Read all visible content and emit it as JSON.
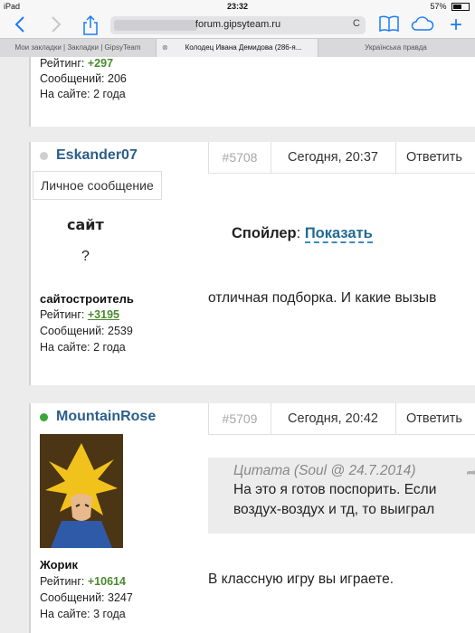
{
  "statusbar": {
    "device": "iPad",
    "time": "23:32",
    "battery": "57%",
    "battery_level": 0.57
  },
  "toolbar": {
    "back_icon": "chevron-left-icon",
    "forward_icon": "chevron-right-icon",
    "share_icon": "share-icon",
    "url": "forum.gipsyteam.ru",
    "reload": "C",
    "bookmarks_icon": "book-icon",
    "cloud_icon": "cloud-icon",
    "new_tab": "+"
  },
  "tabs": [
    {
      "label": "Мои закладки | Закладки | GipsyTeam"
    },
    {
      "label": "Колодец Ивана Демидова (286-я...",
      "close": "⊗"
    },
    {
      "label": "Українська правда"
    }
  ],
  "posts": [
    {
      "stats": {
        "rating_label": "Рейтинг:",
        "rating": "+297",
        "messages": "Сообщений: 206",
        "online": "На сайте: 2 года"
      }
    },
    {
      "username": "Eskander07",
      "pm_button": "Личное сообщение",
      "avatar_text_1": "сайт",
      "avatar_text_2": "?",
      "rank": "сайтостроитель",
      "stats": {
        "rating_label": "Рейтинг:",
        "rating": "+3195",
        "messages": "Сообщений: 2539",
        "online": "На сайте: 2 года"
      },
      "number": "#5708",
      "date": "Сегодня, 20:37",
      "reply": "Ответить",
      "spoiler_label": "Спойлер",
      "spoiler_sep": ":",
      "spoiler_show": "Показать",
      "text": "отличная подборка. И какие вызыв"
    },
    {
      "username": "MountainRose",
      "rank": "Жорик",
      "stats": {
        "rating_label": "Рейтинг:",
        "rating": "+10614",
        "messages": "Сообщений: 3247",
        "online": "На сайте: 3 года"
      },
      "number": "#5709",
      "date": "Сегодня, 20:42",
      "reply": "Ответить",
      "quote_head": "Цитата (Soul @ 24.7.2014)",
      "quote_line_1": "На это я готов поспорить. Если",
      "quote_line_2": "воздух-воздух и тд, то выиграл",
      "text": "В классную игру вы играете."
    }
  ],
  "colors": {
    "link": "#1a7cf5",
    "username": "#2b5f8a",
    "online": "#3aa63a",
    "offline": "#cfcfcf",
    "rating": "#4a8a2c"
  }
}
